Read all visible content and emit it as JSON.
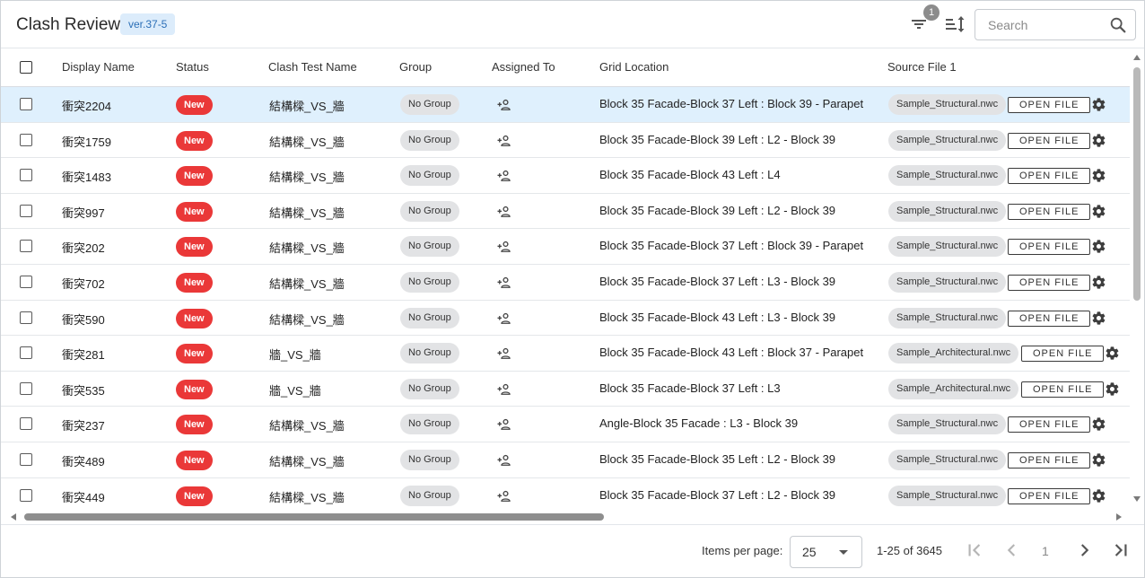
{
  "header": {
    "title": "Clash Review",
    "version": "ver.37-5",
    "filter_count": "1",
    "search_placeholder": "Search"
  },
  "columns": {
    "display_name": "Display Name",
    "status": "Status",
    "clash_test_name": "Clash Test Name",
    "group": "Group",
    "assigned_to": "Assigned To",
    "grid_location": "Grid Location",
    "source_file_1": "Source File 1"
  },
  "open_file_label": "OPEN FILE",
  "rows": [
    {
      "name": "衝突2204",
      "status": "New",
      "test": "結構樑_VS_牆",
      "group": "No Group",
      "grid": "Block 35 Facade-Block 37 Left : Block 39 - Parapet",
      "file": "Sample_Structural.nwc",
      "selected": true
    },
    {
      "name": "衝突1759",
      "status": "New",
      "test": "結構樑_VS_牆",
      "group": "No Group",
      "grid": "Block 35 Facade-Block 39 Left : L2 - Block 39",
      "file": "Sample_Structural.nwc"
    },
    {
      "name": "衝突1483",
      "status": "New",
      "test": "結構樑_VS_牆",
      "group": "No Group",
      "grid": "Block 35 Facade-Block 43 Left : L4",
      "file": "Sample_Structural.nwc"
    },
    {
      "name": "衝突997",
      "status": "New",
      "test": "結構樑_VS_牆",
      "group": "No Group",
      "grid": "Block 35 Facade-Block 39 Left : L2 - Block 39",
      "file": "Sample_Structural.nwc"
    },
    {
      "name": "衝突202",
      "status": "New",
      "test": "結構樑_VS_牆",
      "group": "No Group",
      "grid": "Block 35 Facade-Block 37 Left : Block 39 - Parapet",
      "file": "Sample_Structural.nwc"
    },
    {
      "name": "衝突702",
      "status": "New",
      "test": "結構樑_VS_牆",
      "group": "No Group",
      "grid": "Block 35 Facade-Block 37 Left : L3 - Block 39",
      "file": "Sample_Structural.nwc"
    },
    {
      "name": "衝突590",
      "status": "New",
      "test": "結構樑_VS_牆",
      "group": "No Group",
      "grid": "Block 35 Facade-Block 43 Left : L3 - Block 39",
      "file": "Sample_Structural.nwc"
    },
    {
      "name": "衝突281",
      "status": "New",
      "test": "牆_VS_牆",
      "group": "No Group",
      "grid": "Block 35 Facade-Block 43 Left : Block 37 - Parapet",
      "file": "Sample_Architectural.nwc"
    },
    {
      "name": "衝突535",
      "status": "New",
      "test": "牆_VS_牆",
      "group": "No Group",
      "grid": "Block 35 Facade-Block 37 Left : L3",
      "file": "Sample_Architectural.nwc"
    },
    {
      "name": "衝突237",
      "status": "New",
      "test": "結構樑_VS_牆",
      "group": "No Group",
      "grid": "Angle-Block 35 Facade : L3 - Block 39",
      "file": "Sample_Structural.nwc"
    },
    {
      "name": "衝突489",
      "status": "New",
      "test": "結構樑_VS_牆",
      "group": "No Group",
      "grid": "Block 35 Facade-Block 35 Left : L2 - Block 39",
      "file": "Sample_Structural.nwc"
    },
    {
      "name": "衝突449",
      "status": "New",
      "test": "結構樑_VS_牆",
      "group": "No Group",
      "grid": "Block 35 Facade-Block 37 Left : L2 - Block 39",
      "file": "Sample_Structural.nwc"
    }
  ],
  "paginator": {
    "items_per_page_label": "Items per page:",
    "items_per_page": "25",
    "range": "1-25 of 3645",
    "page": "1"
  },
  "colors": {
    "status_new": "#ea3838",
    "selected_row": "#dff0fd",
    "version_badge_bg": "#dcecfb",
    "chip_bg": "#e2e3e5"
  }
}
